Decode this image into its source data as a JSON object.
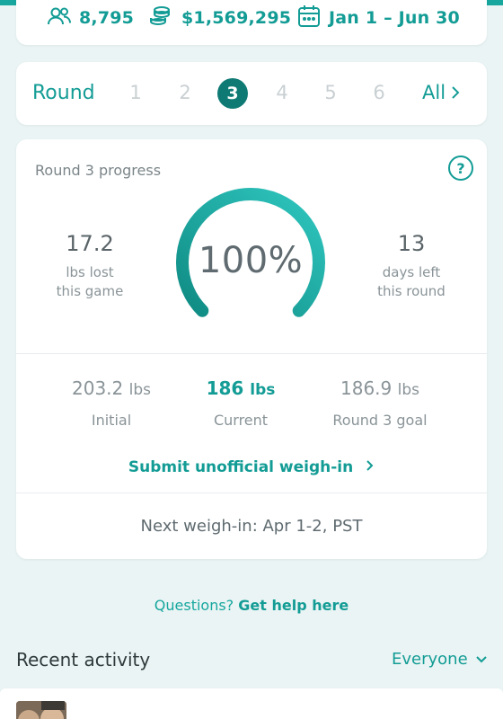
{
  "stats": {
    "participants": "8,795",
    "pot": "$1,569,295",
    "dates": "Jan 1 – Jun 30"
  },
  "round_selector": {
    "label": "Round",
    "rounds": [
      "1",
      "2",
      "3",
      "4",
      "5",
      "6"
    ],
    "active_round": "3",
    "all_label": "All"
  },
  "progress": {
    "title": "Round 3 progress",
    "lbs_lost_value": "17.2",
    "lbs_lost_label_1": "lbs lost",
    "lbs_lost_label_2": "this game",
    "percent_text": "100%",
    "percent_value": 100,
    "days_left_value": "13",
    "days_left_label_1": "days left",
    "days_left_label_2": "this round",
    "initial_value": "203.2",
    "initial_label": "Initial",
    "current_value": "186",
    "current_label": "Current",
    "goal_value": "186.9",
    "goal_label": "Round 3 goal",
    "unit": "lbs",
    "submit_label": "Submit unofficial weigh-in",
    "next_weigh_in": "Next weigh-in: Apr 1-2, PST"
  },
  "help": {
    "question": "Questions?",
    "link": "Get help here"
  },
  "activity": {
    "title": "Recent activity",
    "filter": "Everyone"
  },
  "colors": {
    "accent": "#139c95",
    "active_round": "#0f7a74",
    "background": "#eaf4f4"
  }
}
